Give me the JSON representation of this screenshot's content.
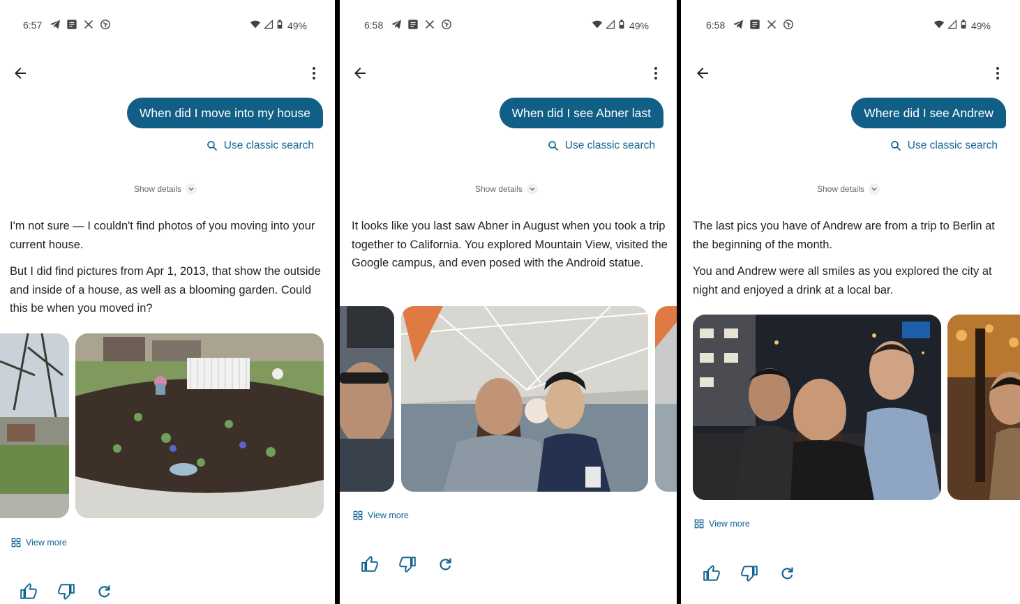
{
  "colors": {
    "bubble": "#115e86",
    "link": "#116491",
    "text": "#222222",
    "divider": "#000000"
  },
  "status_battery": "49%",
  "icons": {
    "status_left": [
      "telegram-icon",
      "message-icon",
      "x-icon",
      "podcast-icon"
    ],
    "status_right": [
      "wifi-icon",
      "signal-icon",
      "battery-icon"
    ],
    "nav": [
      "back-arrow-icon",
      "more-vert-icon"
    ],
    "search": "search-icon",
    "view_more": "grid-icon",
    "feedback": [
      "thumbs-up-icon",
      "thumbs-down-icon",
      "refresh-icon"
    ]
  },
  "panels": [
    {
      "time": "6:57",
      "query": "When did I move into my house",
      "classic_search": "Use classic search",
      "show_details": "Show details",
      "answer": [
        "I'm not sure — I couldn't find photos of you moving into your current house.",
        "But I did find pictures from Apr 1, 2013, that show the outside and inside of a house, as well as a blooming garden. Could this be when you moved in?"
      ],
      "view_more": "View more"
    },
    {
      "time": "6:58",
      "query": "When did I see Abner last",
      "classic_search": "Use classic search",
      "show_details": "Show details",
      "answer": [
        "It looks like you last saw Abner in August when you took a trip together to California. You explored Mountain View, visited the Google campus, and even posed with the Android statue."
      ],
      "view_more": "View more"
    },
    {
      "time": "6:58",
      "query": "Where did I see Andrew",
      "classic_search": "Use classic search",
      "show_details": "Show details",
      "answer": [
        "The last pics you have of Andrew are from a trip to Berlin at the beginning of the month.",
        "You and Andrew were all smiles as you explored the city at night and enjoyed a drink at a local bar."
      ],
      "view_more": "View more"
    }
  ]
}
